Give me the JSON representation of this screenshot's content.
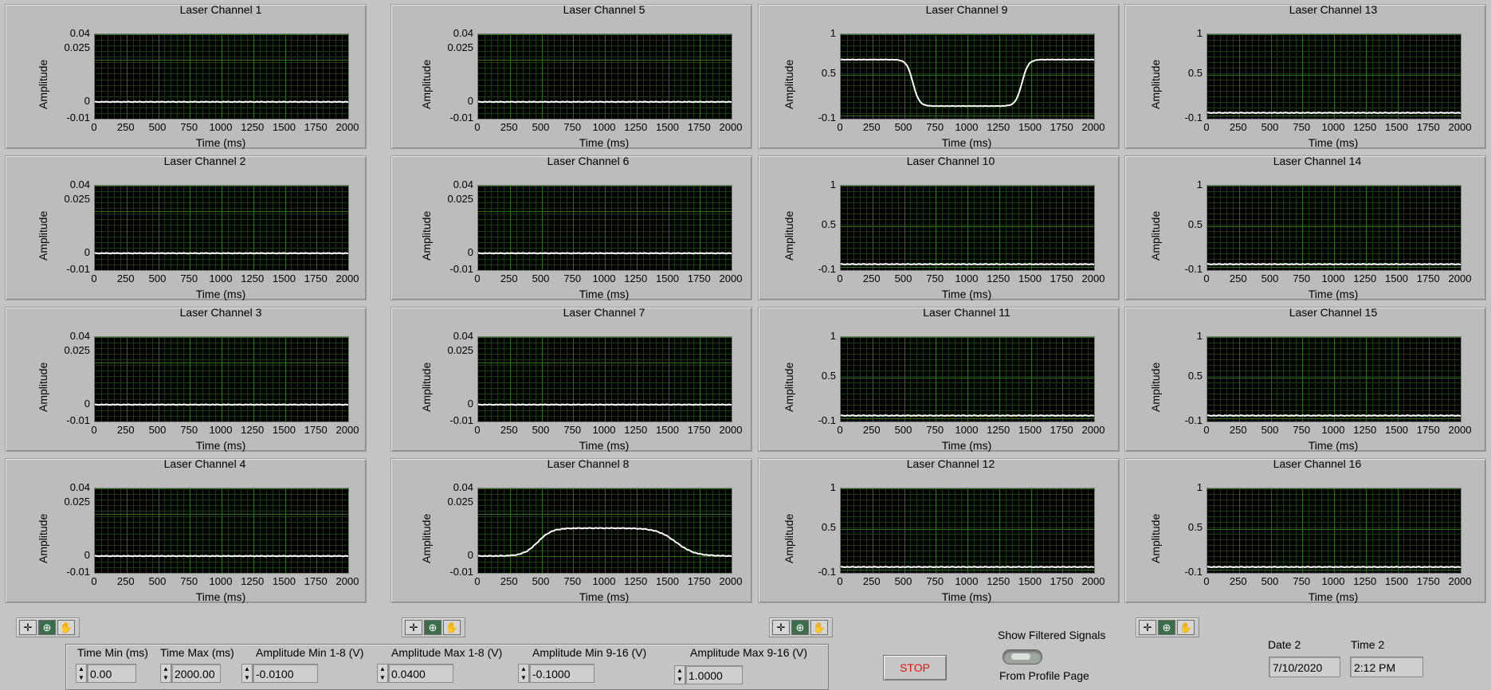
{
  "charts": [
    {
      "title": "Laser Channel 1",
      "y_ticks": [
        "0.04",
        "0.025",
        "0",
        "-0.01"
      ],
      "trace": "flat0"
    },
    {
      "title": "Laser Channel 2",
      "y_ticks": [
        "0.04",
        "0.025",
        "0",
        "-0.01"
      ],
      "trace": "flat0"
    },
    {
      "title": "Laser Channel 3",
      "y_ticks": [
        "0.04",
        "0.025",
        "0",
        "-0.01"
      ],
      "trace": "flat0"
    },
    {
      "title": "Laser Channel 4",
      "y_ticks": [
        "0.04",
        "0.025",
        "0",
        "-0.01"
      ],
      "trace": "flat0"
    },
    {
      "title": "Laser Channel 5",
      "y_ticks": [
        "0.04",
        "0.025",
        "0",
        "-0.01"
      ],
      "trace": "flat0"
    },
    {
      "title": "Laser Channel 6",
      "y_ticks": [
        "0.04",
        "0.025",
        "0",
        "-0.01"
      ],
      "trace": "flat0"
    },
    {
      "title": "Laser Channel 7",
      "y_ticks": [
        "0.04",
        "0.025",
        "0",
        "-0.01"
      ],
      "trace": "flat0"
    },
    {
      "title": "Laser Channel 8",
      "y_ticks": [
        "0.04",
        "0.025",
        "0",
        "-0.01"
      ],
      "trace": "plateau"
    },
    {
      "title": "Laser Channel 9",
      "y_ticks": [
        "1",
        "0.5",
        "-0.1"
      ],
      "trace": "dip"
    },
    {
      "title": "Laser Channel 10",
      "y_ticks": [
        "1",
        "0.5",
        "-0.1"
      ],
      "trace": "flatlow"
    },
    {
      "title": "Laser Channel 11",
      "y_ticks": [
        "1",
        "0.5",
        "-0.1"
      ],
      "trace": "flatlow"
    },
    {
      "title": "Laser Channel 12",
      "y_ticks": [
        "1",
        "0.5",
        "-0.1"
      ],
      "trace": "flatlow"
    },
    {
      "title": "Laser Channel 13",
      "y_ticks": [
        "1",
        "0.5",
        "-0.1"
      ],
      "trace": "flatlow"
    },
    {
      "title": "Laser Channel 14",
      "y_ticks": [
        "1",
        "0.5",
        "-0.1"
      ],
      "trace": "flatlow"
    },
    {
      "title": "Laser Channel 15",
      "y_ticks": [
        "1",
        "0.5",
        "-0.1"
      ],
      "trace": "flatlow"
    },
    {
      "title": "Laser Channel 16",
      "y_ticks": [
        "1",
        "0.5",
        "-0.1"
      ],
      "trace": "flatlow"
    }
  ],
  "x_ticks": [
    "0",
    "250",
    "500",
    "750",
    "1000",
    "1250",
    "1500",
    "1750",
    "2000"
  ],
  "x_axis_label": "Time (ms)",
  "y_axis_label": "Amplitude",
  "palette_icons": [
    "crosshair-icon",
    "zoom-icon",
    "hand-icon"
  ],
  "controls": {
    "time_min": {
      "label": "Time Min (ms)",
      "value": "0.00"
    },
    "time_max": {
      "label": "Time Max (ms)",
      "value": "2000.00"
    },
    "amp_min_1_8": {
      "label": "Amplitude Min 1-8 (V)",
      "value": "-0.0100"
    },
    "amp_max_1_8": {
      "label": "Amplitude Max 1-8 (V)",
      "value": "0.0400"
    },
    "amp_min_9_16": {
      "label": "Amplitude Min 9-16 (V)",
      "value": "-0.1000"
    },
    "amp_max_9_16": {
      "label": "Amplitude Max 9-16 (V)",
      "value": "1.0000"
    }
  },
  "stop_label": "STOP",
  "show_filtered_label": "Show Filtered Signals",
  "from_profile_label": "From Profile Page",
  "date_label": "Date 2",
  "date_value": "7/10/2020",
  "time_label": "Time 2",
  "time_value": "2:12 PM",
  "colors": {
    "plot_bg": "#000000",
    "grid": "#2f6d1a",
    "trace": "#ffffff",
    "stop_text": "#e3120b"
  }
}
